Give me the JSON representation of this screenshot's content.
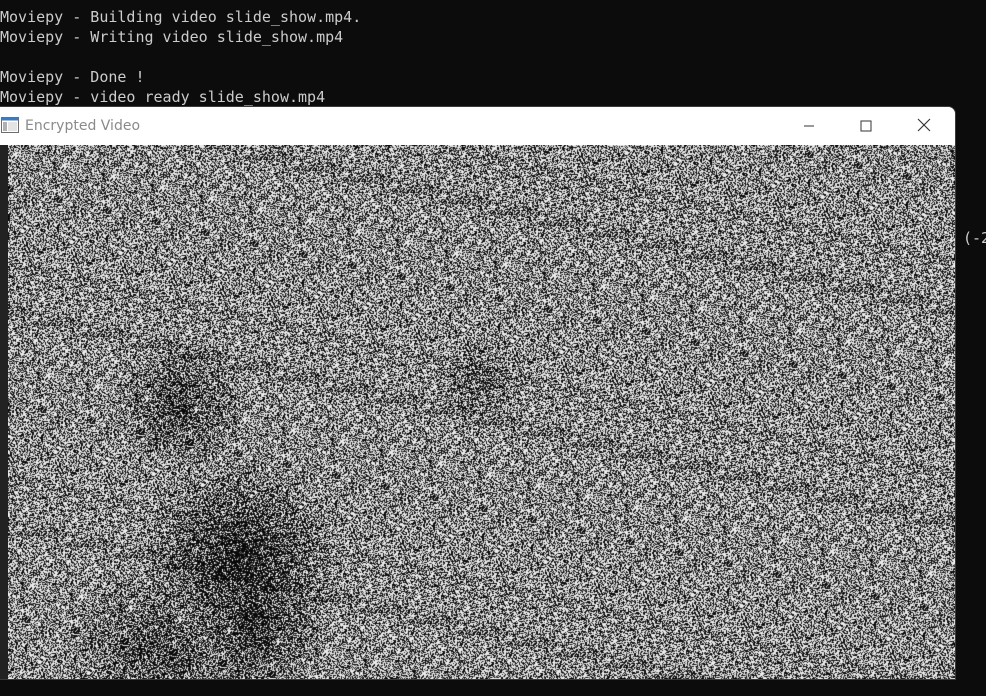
{
  "terminal": {
    "lines": [
      "Moviepy - Building video slide_show.mp4.",
      "Moviepy - Writing video slide_show.mp4",
      "",
      "Moviepy - Done !",
      "Moviepy - video ready slide_show.mp4"
    ],
    "side_fragment": "(-2"
  },
  "window": {
    "title": "Encrypted Video",
    "icon": "app-window-icon",
    "controls": [
      "minimize-icon",
      "maximize-icon",
      "close-icon"
    ]
  },
  "video": {
    "content": "scrambled noise frame"
  },
  "colors": {
    "terminal_bg": "#0c0c0c",
    "terminal_fg": "#cccccc",
    "titlebar_bg": "#ffffff",
    "title_fg": "#8a8a8a"
  }
}
